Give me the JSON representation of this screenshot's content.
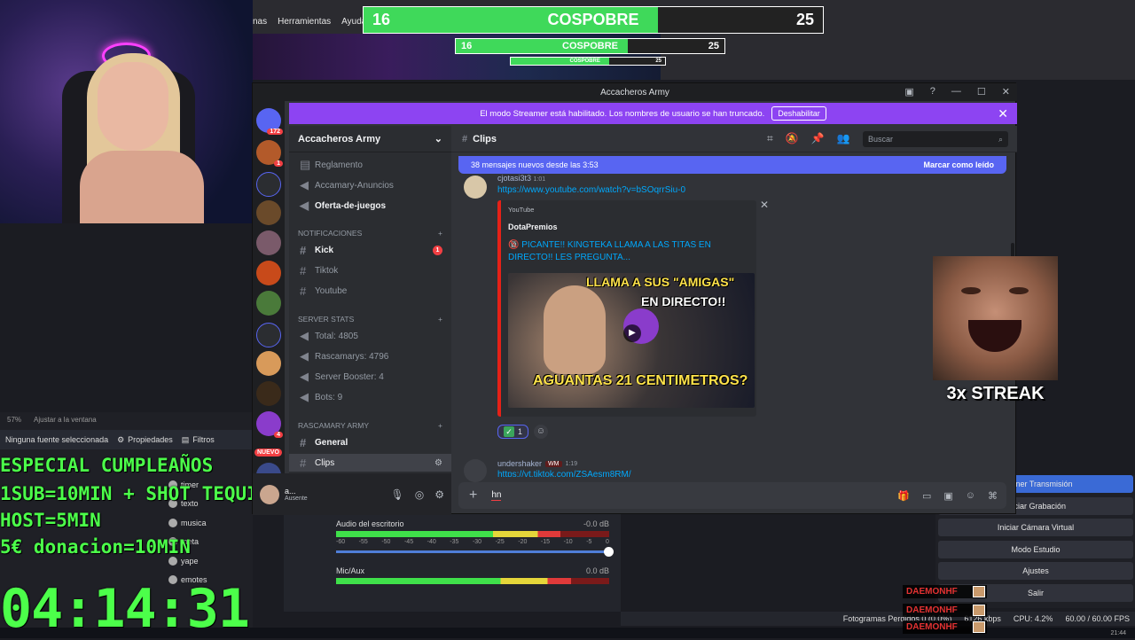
{
  "obs": {
    "menu": [
      "nas",
      "Herramientas",
      "Ayuda"
    ],
    "scale_label": "57%",
    "fit_label": "Ajustar a la ventana",
    "no_source": "Ninguna fuente seleccionada",
    "properties": "Propiedades",
    "filters": "Filtros",
    "scenes": [
      "timer",
      "texto",
      "musica",
      "meta",
      "yape",
      "emotes"
    ],
    "mixer": {
      "desktop_label": "Audio del escritorio",
      "desktop_db": "-0.0 dB",
      "desktop_level": 0.82,
      "mic_label": "Mic/Aux",
      "mic_db": "0.0 dB",
      "mic_level": 0.86,
      "ticks": [
        "-60",
        "-55",
        "-50",
        "-45",
        "-40",
        "-35",
        "-30",
        "-25",
        "-20",
        "-15",
        "-10",
        "-5",
        "0"
      ]
    },
    "controls": [
      "Detener Transmisión",
      "Iniciar Grabación",
      "Iniciar Cámara Virtual",
      "Modo Estudio",
      "Ajustes",
      "Salir"
    ],
    "status": {
      "dropped": "Fotogramas Perdidos 0 (0.0%)",
      "kbps": "6126 kbps",
      "cpu": "CPU: 4.2%",
      "fps": "60.00 / 60.00 FPS"
    },
    "clock": "21:44"
  },
  "overlays": {
    "cospobre": {
      "left": "16",
      "label": "COSPOBRE",
      "right": "25",
      "fill": 0.64
    },
    "promo": [
      "ESPECIAL CUMPLEAÑOS",
      "1SUB=10MIN + SHOT TEQUILA",
      "HOST=5MIN",
      "5€ donacion=10MIN"
    ],
    "timer": "04:14:31",
    "streak": "3x STREAK",
    "alerts": [
      "DAEMONHF",
      "DAEMONHF",
      "DAEMONHF"
    ]
  },
  "discord": {
    "window_title": "Accacheros Army",
    "banner_text": "El modo Streamer está habilitado. Los nombres de usuario se han truncado.",
    "banner_button": "Deshabilitar",
    "guild_badges": [
      "172",
      "1",
      "4"
    ],
    "new_badge": "NUEVO",
    "server_name": "Accacheros Army",
    "channels_top": [
      "Reglamento",
      "Accamary-Anuncios",
      "Oferta-de-juegos"
    ],
    "cat_notifications": "NOTIFICACIONES",
    "notif_channels": [
      "Kick",
      "Tiktok",
      "Youtube"
    ],
    "kick_badge": "1",
    "cat_stats": "SERVER STATS",
    "stat_channels": [
      "Total: 4805",
      "Rascamarys: 4796",
      "Server Booster: 4",
      "Bots: 9"
    ],
    "cat_army": "RASCAMARY ARMY",
    "army_channels": [
      "General",
      "Clips"
    ],
    "user": {
      "name": "a...",
      "status": "Ausente"
    },
    "channel_header": "Clips",
    "search_placeholder": "Buscar",
    "new_messages": "38 mensajes nuevos desde las 3:53",
    "mark_read": "Marcar como leído",
    "msg1": {
      "author": "cjotasi3t3",
      "time": "1:01",
      "link": "https://www.youtube.com/watch?v=bSOqrrSiu-0",
      "embed_provider": "YouTube",
      "embed_author": "DotaPremios",
      "embed_title": "🔞 PICANTE!! KINGTEKA LLAMA A LAS TITAS EN DIRECTO!! LES PREGUNTA...",
      "thumb_line1": "LLAMA A SUS \"AMIGAS\"",
      "thumb_line2": "EN DIRECTO!!",
      "thumb_line3": "AGUANTAS 21 CENTIMETROS?",
      "reaction_count": "1"
    },
    "msg2": {
      "author": "undershaker",
      "tag": "WM",
      "time": "1:19",
      "link": "https://vt.tiktok.com/ZSAesm8RM/"
    },
    "composer_text": "hn"
  }
}
